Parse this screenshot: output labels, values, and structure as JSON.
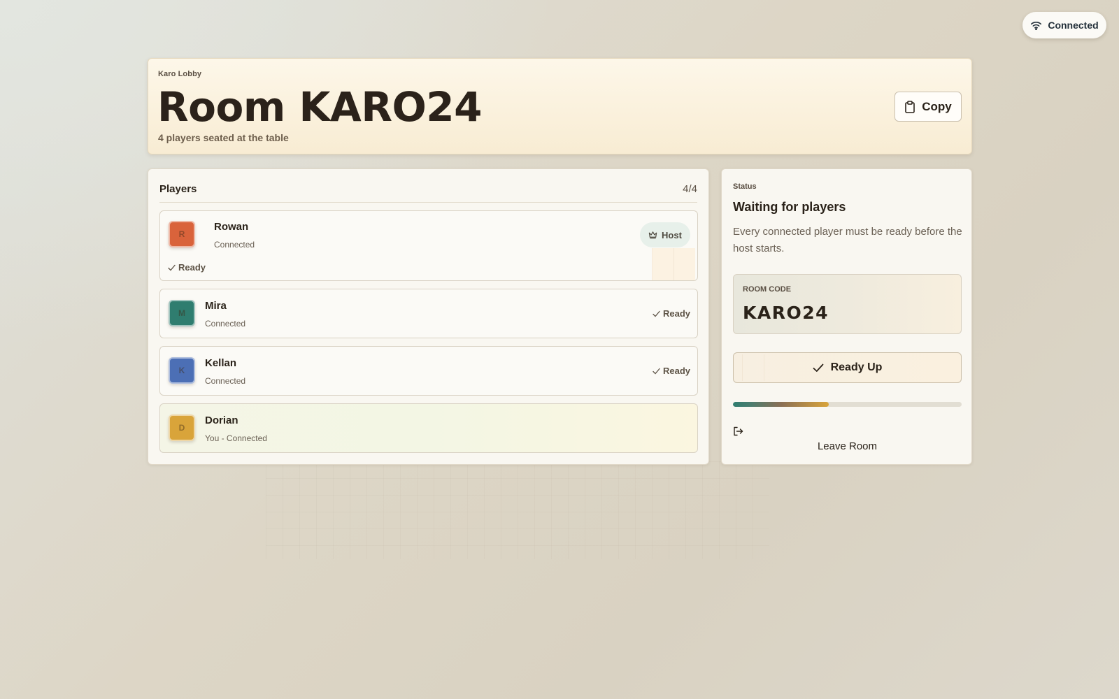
{
  "connection": {
    "label": "Connected",
    "icon": "wifi-icon"
  },
  "header": {
    "eyebrow": "Karo Lobby",
    "title": "Room KARO24",
    "subtitle": "4 players seated at the table",
    "copy_label": "Copy",
    "copy_icon": "clipboard-icon"
  },
  "players": {
    "title": "Players",
    "count": "4/4",
    "items": [
      {
        "name": "Rowan",
        "initial": "R",
        "status": "Connected",
        "ready": "Ready",
        "badge": "Host",
        "color": "#d9633b"
      },
      {
        "name": "Mira",
        "initial": "M",
        "status": "Connected",
        "ready": "Ready",
        "color": "#2f7d6f"
      },
      {
        "name": "Kellan",
        "initial": "K",
        "status": "Connected",
        "ready": "Ready",
        "color": "#4c6fb5"
      },
      {
        "name": "Dorian",
        "initial": "D",
        "status": "You - Connected",
        "color": "#d9a43a"
      }
    ]
  },
  "status": {
    "eyebrow": "Status",
    "title": "Waiting for players",
    "description": "Every connected player must be ready before the host starts.",
    "code_label": "ROOM CODE",
    "code_value": "KARO24",
    "ready_button": "Ready Up",
    "ready_progress": 0.42,
    "leave_label": "Leave Room",
    "leave_icon": "exit-icon"
  },
  "colors": {
    "accent_teal": "#2f7d6f",
    "accent_gold": "#d9a43a",
    "host_badge_bg": "#e7f0ea"
  }
}
